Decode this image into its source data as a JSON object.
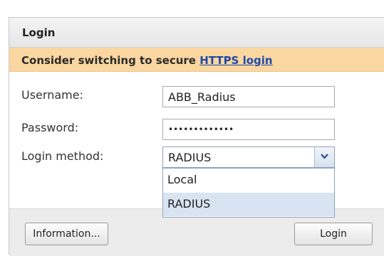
{
  "panel": {
    "title": "Login"
  },
  "notice": {
    "text": "Consider switching to secure ",
    "link_text": "HTTPS login"
  },
  "form": {
    "username_label": "Username:",
    "username_value": "ABB_Radius",
    "password_label": "Password:",
    "password_value": "•••••••••••••",
    "login_method_label": "Login method:",
    "login_method_value": "RADIUS",
    "login_method_options": [
      "Local",
      "RADIUS"
    ]
  },
  "buttons": {
    "information": "Information...",
    "login": "Login"
  },
  "icons": {
    "dropdown": "chevron-down-icon"
  },
  "colors": {
    "notice_bg": "#fad6a1",
    "link": "#1f4aa8",
    "selected_option_bg": "#d9e4f2"
  }
}
